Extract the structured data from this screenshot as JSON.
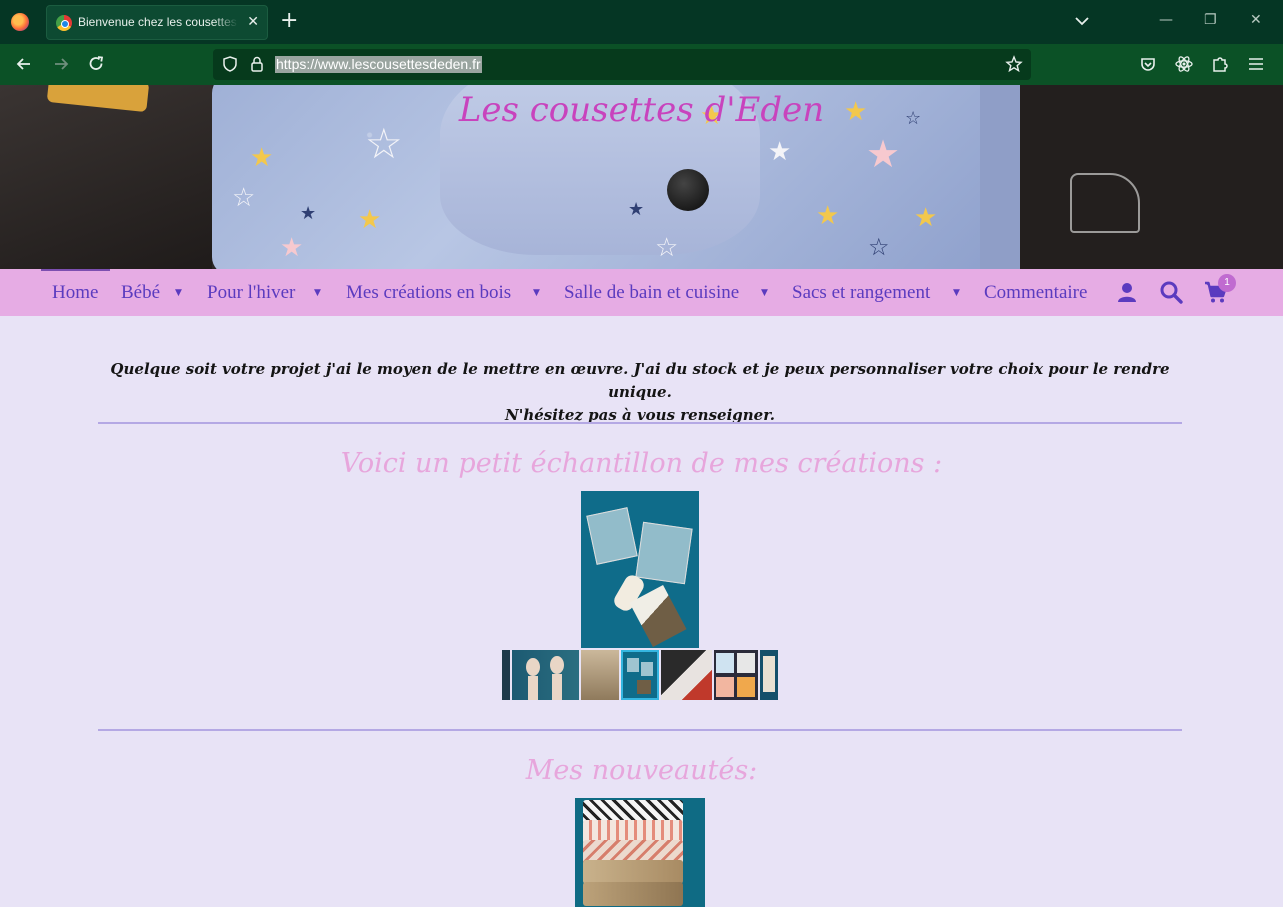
{
  "browser": {
    "tab_title": "Bienvenue chez les cousettes d'Eden",
    "tab_close": "✕",
    "new_tab": "+",
    "url": "https://www.lescousettesdeden.fr",
    "win_minimize": "—",
    "win_restore": "❐",
    "win_close": "✕"
  },
  "site": {
    "title": "Les cousettes d'Eden",
    "menu": {
      "home": "Home",
      "bebe": "Bébé",
      "hiver": "Pour l'hiver",
      "bois": "Mes créations en bois",
      "salle": "Salle de bain et cuisine",
      "sacs": "Sacs et rangement",
      "commentaire": "Commentaire",
      "caret": "▼",
      "cart_count": "1"
    },
    "intro_line1": "Quelque soit votre projet j'ai le moyen de le mettre en œuvre. J'ai du stock et je peux personnaliser votre choix pour le rendre unique.",
    "intro_line2": "N'hésitez pas à vous renseigner.",
    "sample_title": "Voici un petit échantillon de mes créations :",
    "new_title": "Mes nouveautés:"
  },
  "colors": {
    "site_title": "#c843bd",
    "menu_bg": "#e6ace4",
    "menu_text": "#5b3bbf",
    "page_bg": "#e8e3f6",
    "section_title": "#e7a6dc",
    "divider": "#b4a8e4",
    "browser_tabbar": "#053624",
    "browser_navbar": "#0b5126"
  },
  "icons": [
    "firefox-logo-icon",
    "back-icon",
    "forward-icon",
    "reload-icon",
    "shield-icon",
    "lock-icon",
    "bookmark-star-icon",
    "pocket-icon",
    "extension-icon",
    "puzzle-icon",
    "hamburger-menu-icon",
    "user-icon",
    "search-icon",
    "cart-icon"
  ]
}
